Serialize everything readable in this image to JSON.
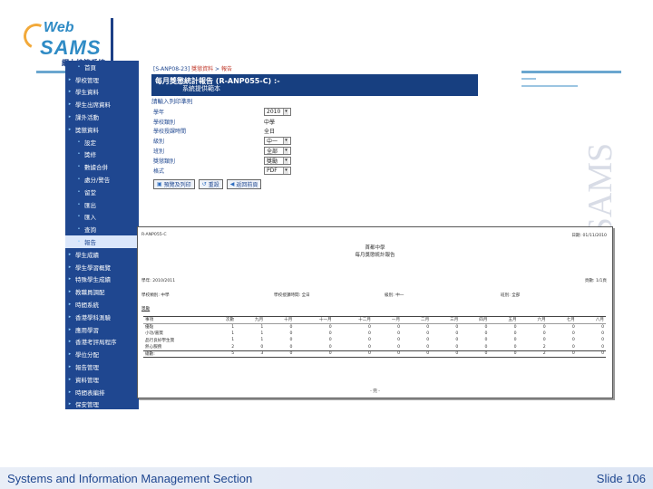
{
  "logo": {
    "web": "Web",
    "sams": "SAMS",
    "subtitle": "網上校管系統"
  },
  "watermark": "WebSAMS",
  "sidebar": {
    "items": [
      {
        "label": "首頁",
        "kind": "sub"
      },
      {
        "label": "學校管理",
        "kind": "top"
      },
      {
        "label": "學生資料",
        "kind": "top"
      },
      {
        "label": "學生出席資料",
        "kind": "top"
      },
      {
        "label": "課外活動",
        "kind": "top"
      },
      {
        "label": "獎懲資料",
        "kind": "top"
      },
      {
        "label": "設定",
        "kind": "sub"
      },
      {
        "label": "獎修",
        "kind": "sub"
      },
      {
        "label": "數據合併",
        "kind": "sub"
      },
      {
        "label": "處分/警告",
        "kind": "sub"
      },
      {
        "label": "留堂",
        "kind": "sub"
      },
      {
        "label": "匯出",
        "kind": "sub"
      },
      {
        "label": "匯入",
        "kind": "sub"
      },
      {
        "label": "查詢",
        "kind": "sub"
      },
      {
        "label": "報告",
        "kind": "sub",
        "active": true
      },
      {
        "label": "學生成績",
        "kind": "top"
      },
      {
        "label": "學生學習概覽",
        "kind": "top"
      },
      {
        "label": "特殊學生成績",
        "kind": "top"
      },
      {
        "label": "教職員調配",
        "kind": "top"
      },
      {
        "label": "時間系統",
        "kind": "top"
      },
      {
        "label": "香港學科測驗",
        "kind": "top"
      },
      {
        "label": "應用學習",
        "kind": "top"
      },
      {
        "label": "香港考評局程序",
        "kind": "top"
      },
      {
        "label": "學位分配",
        "kind": "top"
      },
      {
        "label": "報告管理",
        "kind": "top"
      },
      {
        "label": "資料管理",
        "kind": "top"
      },
      {
        "label": "時間表編排",
        "kind": "top"
      },
      {
        "label": "保安管理",
        "kind": "top"
      }
    ]
  },
  "form": {
    "breadcrumb_code": "[S-ANP08-23]",
    "breadcrumb_section": "獎懲資料",
    "breadcrumb_sep": ">",
    "breadcrumb_page": "報告",
    "title_line1": "每月獎懲統計報告 (R-ANP055-C) :-",
    "title_line2": "系統提供範本",
    "prompt": "請輸入列印準則",
    "fields": [
      {
        "label": "學年",
        "type": "select",
        "value": "2010",
        "width": 30
      },
      {
        "label": "學校類別",
        "type": "text",
        "value": "中學"
      },
      {
        "label": "學校授課時間",
        "type": "text",
        "value": "全日"
      },
      {
        "label": "級別",
        "type": "select",
        "value": "中一",
        "width": 30
      },
      {
        "label": "班別",
        "type": "select",
        "value": "全部",
        "width": 30
      },
      {
        "label": "獎懲類別",
        "type": "select",
        "value": "獎勵",
        "width": 30
      },
      {
        "label": "格式",
        "type": "select",
        "value": "PDF",
        "width": 30
      }
    ],
    "buttons": [
      {
        "label": "預覽及列印",
        "icon": "▣"
      },
      {
        "label": "重設",
        "icon": "↺"
      },
      {
        "label": "返回前頁",
        "icon": "◀"
      }
    ]
  },
  "report": {
    "code": "R-ANP055-C",
    "date": "日期: 01/11/2010",
    "school": "首都中學",
    "title": "每月獎懲統計報告",
    "year": "學年: 2010/2011",
    "page": "頁數: 1/1頁",
    "school_type": "學校類別: 中學",
    "session": "學校授課時間: 全日",
    "level": "級別: 中一",
    "cls": "班別: 全部",
    "category": "獎勵",
    "headers": [
      "事項",
      "次數",
      "九月",
      "十月",
      "十一月",
      "十二月",
      "一月",
      "二月",
      "三月",
      "四月",
      "五月",
      "六月",
      "七月",
      "八月"
    ],
    "rows": [
      [
        "優點",
        "1",
        "1",
        "0",
        "0",
        "0",
        "0",
        "0",
        "0",
        "0",
        "0",
        "0",
        "0",
        "0"
      ],
      [
        "小功/嘉獎",
        "1",
        "1",
        "0",
        "0",
        "0",
        "0",
        "0",
        "0",
        "0",
        "0",
        "0",
        "0",
        "0"
      ],
      [
        "品行良好學生獎",
        "1",
        "1",
        "0",
        "0",
        "0",
        "0",
        "0",
        "0",
        "0",
        "0",
        "0",
        "0",
        "0"
      ],
      [
        "熱心服務",
        "2",
        "0",
        "0",
        "0",
        "0",
        "0",
        "0",
        "0",
        "0",
        "0",
        "2",
        "0",
        "0"
      ]
    ],
    "total": [
      "總數:",
      "5",
      "3",
      "0",
      "0",
      "0",
      "0",
      "0",
      "0",
      "0",
      "0",
      "2",
      "0",
      "0"
    ],
    "footer": "- 完 -"
  },
  "footer": {
    "left": "Systems and Information Management Section",
    "right": "Slide 106"
  }
}
